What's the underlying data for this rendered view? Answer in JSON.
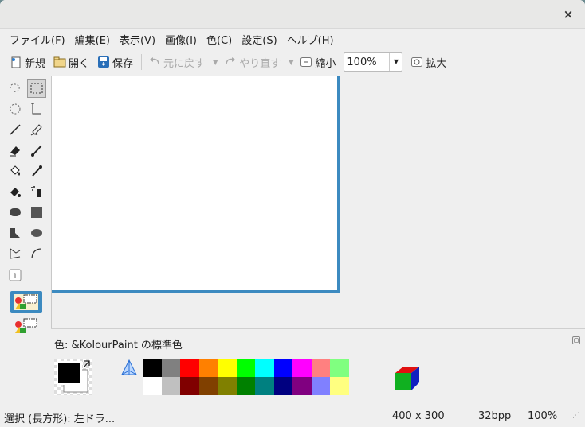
{
  "titlebar": {
    "close": "×"
  },
  "menu": [
    "ファイル(F)",
    "編集(E)",
    "表示(V)",
    "画像(I)",
    "色(C)",
    "設定(S)",
    "ヘルプ(H)"
  ],
  "toolbar": {
    "new_label": "新規",
    "open_label": "開く",
    "save_label": "保存",
    "undo_label": "元に戻す",
    "redo_label": "やり直す",
    "zoom_out_label": "縮小",
    "zoom_value": "100%",
    "zoom_in_label": "拡大"
  },
  "colors": {
    "canvas_border": "#3c8ac0",
    "foreground": "#000000",
    "background": "#ffffff"
  },
  "palette": {
    "title": "色: &KolourPaint の標準色",
    "row1": [
      "#000000",
      "#808080",
      "#ff0000",
      "#ff8000",
      "#ffff00",
      "#00ff00",
      "#00ffff",
      "#0000ff",
      "#ff00ff",
      "#ff8080",
      "#80ff80"
    ],
    "row2": [
      "#ffffff",
      "#c0c0c0",
      "#800000",
      "#804000",
      "#808000",
      "#008000",
      "#008080",
      "#000080",
      "#800080",
      "#8080ff",
      "#ffff80"
    ]
  },
  "status": {
    "tool": "選択 (長方形): 左ドラ...",
    "size": "400 x 300",
    "depth": "32bpp",
    "zoom": "100%"
  }
}
